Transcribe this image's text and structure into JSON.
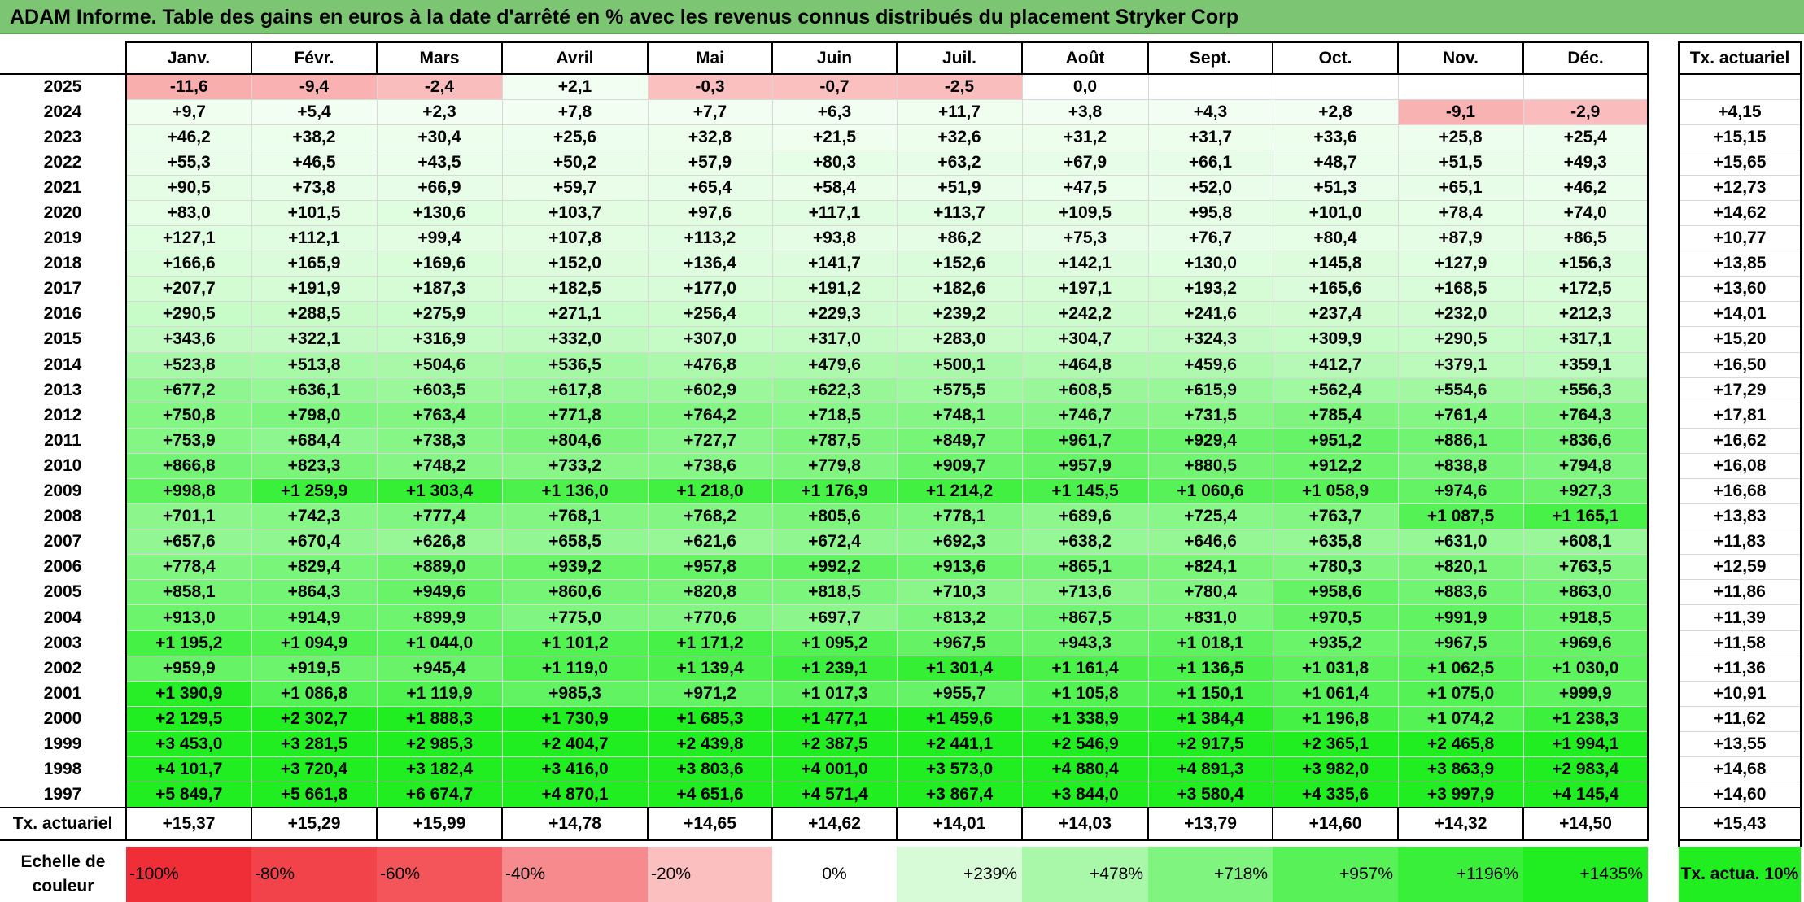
{
  "title": "ADAM Informe. Table des gains en euros à la date d'arrêté en % avec les revenus connus distribués du placement Stryker Corp",
  "months": [
    "Janv.",
    "Févr.",
    "Mars",
    "Avril",
    "Mai",
    "Juin",
    "Juil.",
    "Août",
    "Sept.",
    "Oct.",
    "Nov.",
    "Déc."
  ],
  "side_header": "Tx. actuariel",
  "colors": {
    "title_bg": "#7cc573",
    "positive_max": "#21ee21",
    "negative_max": "#ee2020",
    "neutral": "#ffffff"
  },
  "rows": [
    {
      "year": "2025",
      "cells": [
        "-11,6",
        "-9,4",
        "-2,4",
        "+2,1",
        "-0,3",
        "-0,7",
        "-2,5",
        "0,0",
        "",
        "",
        "",
        ""
      ],
      "num": [
        -11.6,
        -9.4,
        -2.4,
        2.1,
        -0.3,
        -0.7,
        -2.5,
        0.0,
        null,
        null,
        null,
        null
      ],
      "tx": ""
    },
    {
      "year": "2024",
      "cells": [
        "+9,7",
        "+5,4",
        "+2,3",
        "+7,8",
        "+7,7",
        "+6,3",
        "+11,7",
        "+3,8",
        "+4,3",
        "+2,8",
        "-9,1",
        "-2,9"
      ],
      "num": [
        9.7,
        5.4,
        2.3,
        7.8,
        7.7,
        6.3,
        11.7,
        3.8,
        4.3,
        2.8,
        -9.1,
        -2.9
      ],
      "tx": "+4,15"
    },
    {
      "year": "2023",
      "cells": [
        "+46,2",
        "+38,2",
        "+30,4",
        "+25,6",
        "+32,8",
        "+21,5",
        "+32,6",
        "+31,2",
        "+31,7",
        "+33,6",
        "+25,8",
        "+25,4"
      ],
      "num": [
        46.2,
        38.2,
        30.4,
        25.6,
        32.8,
        21.5,
        32.6,
        31.2,
        31.7,
        33.6,
        25.8,
        25.4
      ],
      "tx": "+15,15"
    },
    {
      "year": "2022",
      "cells": [
        "+55,3",
        "+46,5",
        "+43,5",
        "+50,2",
        "+57,9",
        "+80,3",
        "+63,2",
        "+67,9",
        "+66,1",
        "+48,7",
        "+51,5",
        "+49,3"
      ],
      "num": [
        55.3,
        46.5,
        43.5,
        50.2,
        57.9,
        80.3,
        63.2,
        67.9,
        66.1,
        48.7,
        51.5,
        49.3
      ],
      "tx": "+15,65"
    },
    {
      "year": "2021",
      "cells": [
        "+90,5",
        "+73,8",
        "+66,9",
        "+59,7",
        "+65,4",
        "+58,4",
        "+51,9",
        "+47,5",
        "+52,0",
        "+51,3",
        "+65,1",
        "+46,2"
      ],
      "num": [
        90.5,
        73.8,
        66.9,
        59.7,
        65.4,
        58.4,
        51.9,
        47.5,
        52.0,
        51.3,
        65.1,
        46.2
      ],
      "tx": "+12,73"
    },
    {
      "year": "2020",
      "cells": [
        "+83,0",
        "+101,5",
        "+130,6",
        "+103,7",
        "+97,6",
        "+117,1",
        "+113,7",
        "+109,5",
        "+95,8",
        "+101,0",
        "+78,4",
        "+74,0"
      ],
      "num": [
        83.0,
        101.5,
        130.6,
        103.7,
        97.6,
        117.1,
        113.7,
        109.5,
        95.8,
        101.0,
        78.4,
        74.0
      ],
      "tx": "+14,62"
    },
    {
      "year": "2019",
      "cells": [
        "+127,1",
        "+112,1",
        "+99,4",
        "+107,8",
        "+113,2",
        "+93,8",
        "+86,2",
        "+75,3",
        "+76,7",
        "+80,4",
        "+87,9",
        "+86,5"
      ],
      "num": [
        127.1,
        112.1,
        99.4,
        107.8,
        113.2,
        93.8,
        86.2,
        75.3,
        76.7,
        80.4,
        87.9,
        86.5
      ],
      "tx": "+10,77"
    },
    {
      "year": "2018",
      "cells": [
        "+166,6",
        "+165,9",
        "+169,6",
        "+152,0",
        "+136,4",
        "+141,7",
        "+152,6",
        "+142,1",
        "+130,0",
        "+145,8",
        "+127,9",
        "+156,3"
      ],
      "num": [
        166.6,
        165.9,
        169.6,
        152.0,
        136.4,
        141.7,
        152.6,
        142.1,
        130.0,
        145.8,
        127.9,
        156.3
      ],
      "tx": "+13,85"
    },
    {
      "year": "2017",
      "cells": [
        "+207,7",
        "+191,9",
        "+187,3",
        "+182,5",
        "+177,0",
        "+191,2",
        "+182,6",
        "+197,1",
        "+193,2",
        "+165,6",
        "+168,5",
        "+172,5"
      ],
      "num": [
        207.7,
        191.9,
        187.3,
        182.5,
        177.0,
        191.2,
        182.6,
        197.1,
        193.2,
        165.6,
        168.5,
        172.5
      ],
      "tx": "+13,60"
    },
    {
      "year": "2016",
      "cells": [
        "+290,5",
        "+288,5",
        "+275,9",
        "+271,1",
        "+256,4",
        "+229,3",
        "+239,2",
        "+242,2",
        "+241,6",
        "+237,4",
        "+232,0",
        "+212,3"
      ],
      "num": [
        290.5,
        288.5,
        275.9,
        271.1,
        256.4,
        229.3,
        239.2,
        242.2,
        241.6,
        237.4,
        232.0,
        212.3
      ],
      "tx": "+14,01"
    },
    {
      "year": "2015",
      "cells": [
        "+343,6",
        "+322,1",
        "+316,9",
        "+332,0",
        "+307,0",
        "+317,0",
        "+283,0",
        "+304,7",
        "+324,3",
        "+309,9",
        "+290,5",
        "+317,1"
      ],
      "num": [
        343.6,
        322.1,
        316.9,
        332.0,
        307.0,
        317.0,
        283.0,
        304.7,
        324.3,
        309.9,
        290.5,
        317.1
      ],
      "tx": "+15,20"
    },
    {
      "year": "2014",
      "cells": [
        "+523,8",
        "+513,8",
        "+504,6",
        "+536,5",
        "+476,8",
        "+479,6",
        "+500,1",
        "+464,8",
        "+459,6",
        "+412,7",
        "+379,1",
        "+359,1"
      ],
      "num": [
        523.8,
        513.8,
        504.6,
        536.5,
        476.8,
        479.6,
        500.1,
        464.8,
        459.6,
        412.7,
        379.1,
        359.1
      ],
      "tx": "+16,50"
    },
    {
      "year": "2013",
      "cells": [
        "+677,2",
        "+636,1",
        "+603,5",
        "+617,8",
        "+602,9",
        "+622,3",
        "+575,5",
        "+608,5",
        "+615,9",
        "+562,4",
        "+554,6",
        "+556,3"
      ],
      "num": [
        677.2,
        636.1,
        603.5,
        617.8,
        602.9,
        622.3,
        575.5,
        608.5,
        615.9,
        562.4,
        554.6,
        556.3
      ],
      "tx": "+17,29"
    },
    {
      "year": "2012",
      "cells": [
        "+750,8",
        "+798,0",
        "+763,4",
        "+771,8",
        "+764,2",
        "+718,5",
        "+748,1",
        "+746,7",
        "+731,5",
        "+785,4",
        "+761,4",
        "+764,3"
      ],
      "num": [
        750.8,
        798.0,
        763.4,
        771.8,
        764.2,
        718.5,
        748.1,
        746.7,
        731.5,
        785.4,
        761.4,
        764.3
      ],
      "tx": "+17,81"
    },
    {
      "year": "2011",
      "cells": [
        "+753,9",
        "+684,4",
        "+738,3",
        "+804,6",
        "+727,7",
        "+787,5",
        "+849,7",
        "+961,7",
        "+929,4",
        "+951,2",
        "+886,1",
        "+836,6"
      ],
      "num": [
        753.9,
        684.4,
        738.3,
        804.6,
        727.7,
        787.5,
        849.7,
        961.7,
        929.4,
        951.2,
        886.1,
        836.6
      ],
      "tx": "+16,62"
    },
    {
      "year": "2010",
      "cells": [
        "+866,8",
        "+823,3",
        "+748,2",
        "+733,2",
        "+738,6",
        "+779,8",
        "+909,7",
        "+957,9",
        "+880,5",
        "+912,2",
        "+838,8",
        "+794,8"
      ],
      "num": [
        866.8,
        823.3,
        748.2,
        733.2,
        738.6,
        779.8,
        909.7,
        957.9,
        880.5,
        912.2,
        838.8,
        794.8
      ],
      "tx": "+16,08"
    },
    {
      "year": "2009",
      "cells": [
        "+998,8",
        "+1 259,9",
        "+1 303,4",
        "+1 136,0",
        "+1 218,0",
        "+1 176,9",
        "+1 214,2",
        "+1 145,5",
        "+1 060,6",
        "+1 058,9",
        "+974,6",
        "+927,3"
      ],
      "num": [
        998.8,
        1259.9,
        1303.4,
        1136.0,
        1218.0,
        1176.9,
        1214.2,
        1145.5,
        1060.6,
        1058.9,
        974.6,
        927.3
      ],
      "tx": "+16,68"
    },
    {
      "year": "2008",
      "cells": [
        "+701,1",
        "+742,3",
        "+777,4",
        "+768,1",
        "+768,2",
        "+805,6",
        "+778,1",
        "+689,6",
        "+725,4",
        "+763,7",
        "+1 087,5",
        "+1 165,1"
      ],
      "num": [
        701.1,
        742.3,
        777.4,
        768.1,
        768.2,
        805.6,
        778.1,
        689.6,
        725.4,
        763.7,
        1087.5,
        1165.1
      ],
      "tx": "+13,83"
    },
    {
      "year": "2007",
      "cells": [
        "+657,6",
        "+670,4",
        "+626,8",
        "+658,5",
        "+621,6",
        "+672,4",
        "+692,3",
        "+638,2",
        "+646,6",
        "+635,8",
        "+631,0",
        "+608,1"
      ],
      "num": [
        657.6,
        670.4,
        626.8,
        658.5,
        621.6,
        672.4,
        692.3,
        638.2,
        646.6,
        635.8,
        631.0,
        608.1
      ],
      "tx": "+11,83"
    },
    {
      "year": "2006",
      "cells": [
        "+778,4",
        "+829,4",
        "+889,0",
        "+939,2",
        "+957,8",
        "+992,2",
        "+913,6",
        "+865,1",
        "+824,1",
        "+780,3",
        "+820,1",
        "+763,5"
      ],
      "num": [
        778.4,
        829.4,
        889.0,
        939.2,
        957.8,
        992.2,
        913.6,
        865.1,
        824.1,
        780.3,
        820.1,
        763.5
      ],
      "tx": "+12,59"
    },
    {
      "year": "2005",
      "cells": [
        "+858,1",
        "+864,3",
        "+949,6",
        "+860,6",
        "+820,8",
        "+818,5",
        "+710,3",
        "+713,6",
        "+780,4",
        "+958,6",
        "+883,6",
        "+863,0"
      ],
      "num": [
        858.1,
        864.3,
        949.6,
        860.6,
        820.8,
        818.5,
        710.3,
        713.6,
        780.4,
        958.6,
        883.6,
        863.0
      ],
      "tx": "+11,86"
    },
    {
      "year": "2004",
      "cells": [
        "+913,0",
        "+914,9",
        "+899,9",
        "+775,0",
        "+770,6",
        "+697,7",
        "+813,2",
        "+867,5",
        "+831,0",
        "+970,5",
        "+991,9",
        "+918,5"
      ],
      "num": [
        913.0,
        914.9,
        899.9,
        775.0,
        770.6,
        697.7,
        813.2,
        867.5,
        831.0,
        970.5,
        991.9,
        918.5
      ],
      "tx": "+11,39"
    },
    {
      "year": "2003",
      "cells": [
        "+1 195,2",
        "+1 094,9",
        "+1 044,0",
        "+1 101,2",
        "+1 171,2",
        "+1 095,2",
        "+967,5",
        "+943,3",
        "+1 018,1",
        "+935,2",
        "+967,5",
        "+969,6"
      ],
      "num": [
        1195.2,
        1094.9,
        1044.0,
        1101.2,
        1171.2,
        1095.2,
        967.5,
        943.3,
        1018.1,
        935.2,
        967.5,
        969.6
      ],
      "tx": "+11,58"
    },
    {
      "year": "2002",
      "cells": [
        "+959,9",
        "+919,5",
        "+945,4",
        "+1 119,0",
        "+1 139,4",
        "+1 239,1",
        "+1 301,4",
        "+1 161,4",
        "+1 136,5",
        "+1 031,8",
        "+1 062,5",
        "+1 030,0"
      ],
      "num": [
        959.9,
        919.5,
        945.4,
        1119.0,
        1139.4,
        1239.1,
        1301.4,
        1161.4,
        1136.5,
        1031.8,
        1062.5,
        1030.0
      ],
      "tx": "+11,36"
    },
    {
      "year": "2001",
      "cells": [
        "+1 390,9",
        "+1 086,8",
        "+1 119,9",
        "+985,3",
        "+971,2",
        "+1 017,3",
        "+955,7",
        "+1 105,8",
        "+1 150,1",
        "+1 061,4",
        "+1 075,0",
        "+999,9"
      ],
      "num": [
        1390.9,
        1086.8,
        1119.9,
        985.3,
        971.2,
        1017.3,
        955.7,
        1105.8,
        1150.1,
        1061.4,
        1075.0,
        999.9
      ],
      "tx": "+10,91"
    },
    {
      "year": "2000",
      "cells": [
        "+2 129,5",
        "+2 302,7",
        "+1 888,3",
        "+1 730,9",
        "+1 685,3",
        "+1 477,1",
        "+1 459,6",
        "+1 338,9",
        "+1 384,4",
        "+1 196,8",
        "+1 074,2",
        "+1 238,3"
      ],
      "num": [
        2129.5,
        2302.7,
        1888.3,
        1730.9,
        1685.3,
        1477.1,
        1459.6,
        1338.9,
        1384.4,
        1196.8,
        1074.2,
        1238.3
      ],
      "tx": "+11,62"
    },
    {
      "year": "1999",
      "cells": [
        "+3 453,0",
        "+3 281,5",
        "+2 985,3",
        "+2 404,7",
        "+2 439,8",
        "+2 387,5",
        "+2 441,1",
        "+2 546,9",
        "+2 917,5",
        "+2 365,1",
        "+2 465,8",
        "+1 994,1"
      ],
      "num": [
        3453.0,
        3281.5,
        2985.3,
        2404.7,
        2439.8,
        2387.5,
        2441.1,
        2546.9,
        2917.5,
        2365.1,
        2465.8,
        1994.1
      ],
      "tx": "+13,55"
    },
    {
      "year": "1998",
      "cells": [
        "+4 101,7",
        "+3 720,4",
        "+3 182,4",
        "+3 416,0",
        "+3 803,6",
        "+4 001,0",
        "+3 573,0",
        "+4 880,4",
        "+4 891,3",
        "+3 982,0",
        "+3 863,9",
        "+2 983,4"
      ],
      "num": [
        4101.7,
        3720.4,
        3182.4,
        3416.0,
        3803.6,
        4001.0,
        3573.0,
        4880.4,
        4891.3,
        3982.0,
        3863.9,
        2983.4
      ],
      "tx": "+14,68"
    },
    {
      "year": "1997",
      "cells": [
        "+5 849,7",
        "+5 661,8",
        "+6 674,7",
        "+4 870,1",
        "+4 651,6",
        "+4 571,4",
        "+3 867,4",
        "+3 844,0",
        "+3 580,4",
        "+4 335,6",
        "+3 997,9",
        "+4 145,4"
      ],
      "num": [
        5849.7,
        5661.8,
        6674.7,
        4870.1,
        4651.6,
        4571.4,
        3867.4,
        3844.0,
        3580.4,
        4335.6,
        3997.9,
        4145.4
      ],
      "tx": "+14,60"
    }
  ],
  "tx_row": {
    "label": "Tx. actuariel",
    "values": [
      "+15,37",
      "+15,29",
      "+15,99",
      "+14,78",
      "+14,65",
      "+14,62",
      "+14,01",
      "+14,03",
      "+13,79",
      "+14,60",
      "+14,32",
      "+14,50"
    ],
    "overall": "+15,43"
  },
  "scale": {
    "label": "Echelle de couleur",
    "items": [
      {
        "text": "-100%",
        "color": "#ef2e38"
      },
      {
        "text": "-80%",
        "color": "#f14349"
      },
      {
        "text": "-60%",
        "color": "#f4555b"
      },
      {
        "text": "-40%",
        "color": "#f78a8c"
      },
      {
        "text": "-20%",
        "color": "#fbbfbf"
      },
      {
        "text": "0%",
        "color": "#ffffff"
      },
      {
        "text": "+239%",
        "color": "#d6fbd6"
      },
      {
        "text": "+478%",
        "color": "#a9f8a9"
      },
      {
        "text": "+718%",
        "color": "#7ff47f"
      },
      {
        "text": "+957%",
        "color": "#58f158"
      },
      {
        "text": "+1196%",
        "color": "#3aef3a"
      },
      {
        "text": "+1435%",
        "color": "#21ee21"
      }
    ],
    "legend": "Tx. actua. 10%"
  }
}
